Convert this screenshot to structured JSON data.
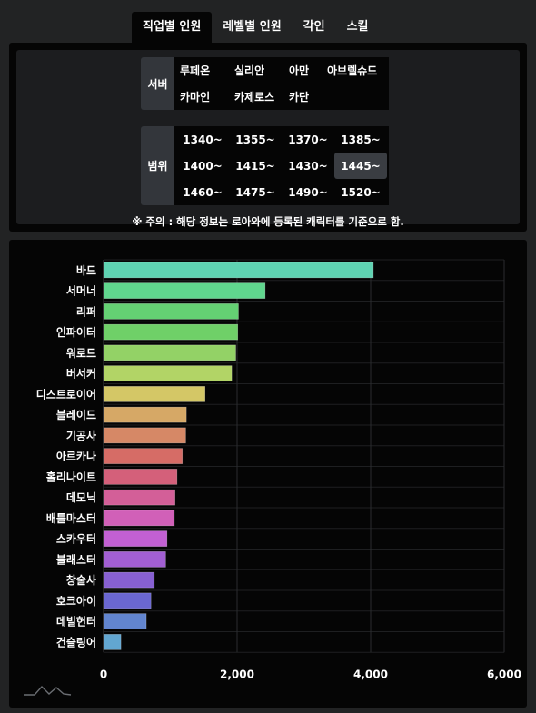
{
  "tabs": [
    {
      "label": "직업별 인원",
      "active": true
    },
    {
      "label": "레벨별 인원",
      "active": false
    },
    {
      "label": "각인",
      "active": false
    },
    {
      "label": "스킬",
      "active": false
    }
  ],
  "server_filter": {
    "label": "서버",
    "options": [
      "루페온",
      "실리안",
      "아만",
      "아브렐슈드",
      "카마인",
      "카제로스",
      "카단"
    ]
  },
  "range_filter": {
    "label": "범위",
    "options": [
      "1340~",
      "1355~",
      "1370~",
      "1385~",
      "1400~",
      "1415~",
      "1430~",
      "1445~",
      "1460~",
      "1475~",
      "1490~",
      "1520~"
    ],
    "selected": "1445~"
  },
  "notice": "※ 주의 : 해당 정보는 로아와에 등록된 캐릭터를 기준으로 함.",
  "chart_data": {
    "type": "bar",
    "orientation": "horizontal",
    "categories": [
      "바드",
      "서머너",
      "리퍼",
      "인파이터",
      "워로드",
      "버서커",
      "디스트로이어",
      "블레이드",
      "기공사",
      "아르카나",
      "홀리나이트",
      "데모닉",
      "배틀마스터",
      "스카우터",
      "블래스터",
      "창술사",
      "호크아이",
      "데빌헌터",
      "건슬링어"
    ],
    "values": [
      4040,
      2420,
      2020,
      2010,
      1980,
      1920,
      1520,
      1240,
      1230,
      1180,
      1100,
      1070,
      1060,
      950,
      930,
      760,
      710,
      640,
      260
    ],
    "colors": [
      "#5fd3b2",
      "#60d68e",
      "#64d173",
      "#6fd068",
      "#93d266",
      "#b2d466",
      "#d4c766",
      "#d6a866",
      "#d68866",
      "#d66c66",
      "#d4607a",
      "#d35f98",
      "#d160b8",
      "#c260d3",
      "#a25fd3",
      "#8760d1",
      "#6a67d1",
      "#6285cf",
      "#62a6d1"
    ],
    "x_ticks": [
      "0",
      "2,000",
      "4,000",
      "6,000"
    ],
    "xlim": [
      0,
      6000
    ],
    "grid": true,
    "legend": "none"
  },
  "logo_icon": "chart-logo-icon"
}
